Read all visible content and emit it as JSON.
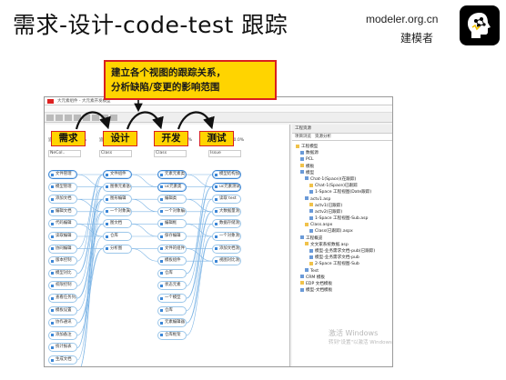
{
  "slide": {
    "title": "需求-设计-code-test  跟踪",
    "site": "modeler.org.cn",
    "brand": "建模者",
    "callout_lines": [
      "建立各个视图的跟踪关系，",
      "分析缺陷/变更的影响范围"
    ],
    "stages": [
      "需求",
      "设计",
      "开发",
      "测试"
    ]
  },
  "app": {
    "title_text": "大元素组件 - 大元素开发模型",
    "column_headers": [
      "追溯",
      "百分比: 14.0%",
      "追溯",
      "百分比: 33.0%",
      "追溯",
      "百分比: 21.3%",
      "追溯",
      "百分比: 0.0%"
    ],
    "column_selects": [
      "NeCol..",
      "Class",
      "Class",
      "Issue"
    ],
    "col1_nodes": [
      "文件管理",
      "模型管理",
      "添加文档",
      "编辑文档",
      "代码编辑",
      "读取编辑",
      "协同编辑",
      "版本控制",
      "模型对比",
      "权限控制",
      "查看任务列表",
      "模板设置",
      "协作通讯",
      "添加备注",
      "统计报表",
      "生成文档",
      "基础服务"
    ],
    "col2_nodes": [
      "文件组件",
      "图像元素基础",
      "图形编辑",
      "一个对象属性",
      "图文档",
      "仓库",
      "分析图"
    ],
    "col3_nodes": [
      "元素元素类",
      "uc元素类",
      "编辑类",
      "一个对象编辑框",
      "编辑框",
      "保存编辑",
      "文件的组件",
      "模板组件",
      "仓库",
      "状态元素",
      "一个模型",
      "仓库",
      "元素编辑器",
      "仓库框架"
    ],
    "col4_nodes": [
      "模型结构加载",
      "uc元素测试",
      "读取 test",
      "大数据量测试",
      "数据存储测试",
      "一个对象测试",
      "添加文档测试",
      "视图对比测试"
    ],
    "right_panel_title": "工程资源",
    "right_tabs": [
      "项目浏览",
      "资源分析"
    ],
    "tree_items": [
      "工程模型",
      "数据源",
      "PCL",
      "模板",
      "模型",
      "Chat-1(Space)(在跟踪)",
      "Chat-1(Space)已跟踪",
      "1-Space 工程视图(Date跟踪)",
      "actv1.asp",
      "actv1(已跟踪)",
      "actv2(已跟踪)",
      "1-Space 工程视图-Sub.asp",
      "Class.aspx",
      "Class(已跟踪).aspx",
      "工程概览",
      "文文家系统数据.asp",
      "模型-业务需求文档-pub(已跟踪)",
      "模型-业务需求文档-pub",
      "2-Space 工程视图-Sub",
      "Test",
      "CRM 模板",
      "EDP 文档模板",
      "模型-文档模板"
    ],
    "watermark_lines": [
      "激活 Windows",
      "转到\"设置\"以激活 Windows。"
    ]
  }
}
